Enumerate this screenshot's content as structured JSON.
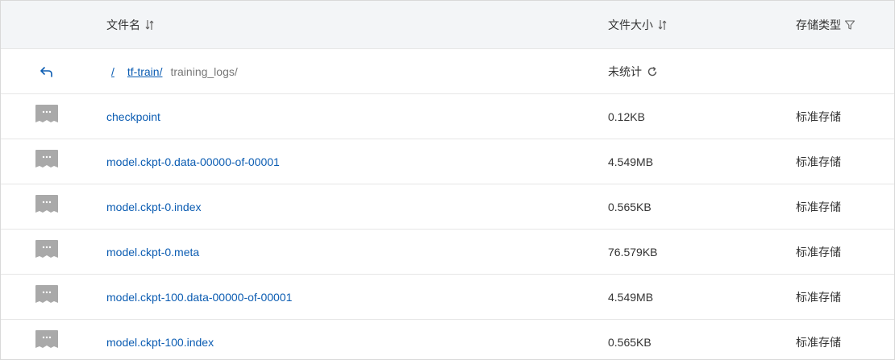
{
  "header": {
    "name_label": "文件名",
    "size_label": "文件大小",
    "type_label": "存储类型"
  },
  "breadcrumb": {
    "root": "/",
    "parent": "tf-train/",
    "current": "training_logs/"
  },
  "nav_row": {
    "size_text": "未统计"
  },
  "colors": {
    "link": "#0b5cb2",
    "header_bg": "#f3f5f7",
    "icon_gray": "#a9a9a9"
  },
  "files": [
    {
      "name": "checkpoint",
      "size": "0.12KB",
      "storage": "标准存储"
    },
    {
      "name": "model.ckpt-0.data-00000-of-00001",
      "size": "4.549MB",
      "storage": "标准存储"
    },
    {
      "name": "model.ckpt-0.index",
      "size": "0.565KB",
      "storage": "标准存储"
    },
    {
      "name": "model.ckpt-0.meta",
      "size": "76.579KB",
      "storage": "标准存储"
    },
    {
      "name": "model.ckpt-100.data-00000-of-00001",
      "size": "4.549MB",
      "storage": "标准存储"
    },
    {
      "name": "model.ckpt-100.index",
      "size": "0.565KB",
      "storage": "标准存储"
    }
  ]
}
